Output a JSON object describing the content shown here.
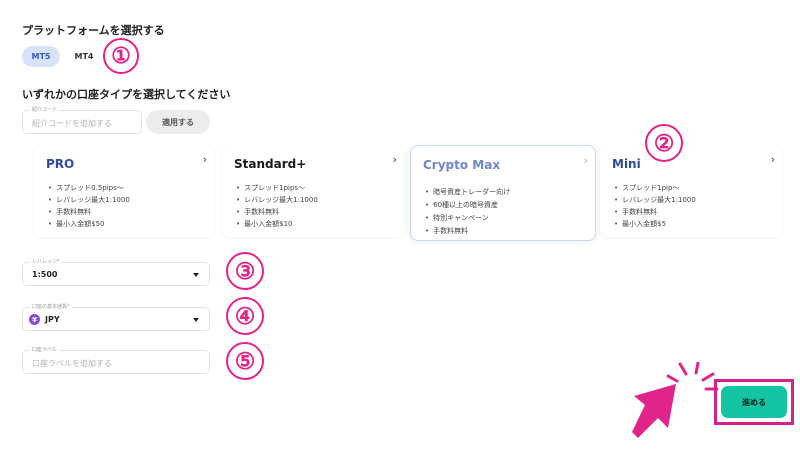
{
  "platform": {
    "title": "プラットフォームを選択する",
    "options": [
      "MT5",
      "MT4"
    ],
    "selected": "MT5"
  },
  "account_type": {
    "title": "いずれかの口座タイプを選択してください"
  },
  "referral": {
    "label": "紹介コード",
    "placeholder": "紹介コードを追加する",
    "apply_label": "適用する"
  },
  "cards": [
    {
      "name": "PRO",
      "features": [
        "スプレッド0.5pips〜",
        "レバレッジ最大1:1000",
        "手数料無料",
        "最小入金額$50"
      ]
    },
    {
      "name": "Standard+",
      "features": [
        "スプレッド1pips〜",
        "レバレッジ最大1:1000",
        "手数料無料",
        "最小入金額$10"
      ]
    },
    {
      "name": "Crypto Max",
      "features": [
        "暗号資産トレーダー向け",
        "60種以上の暗号資産",
        "特別キャンペーン",
        "手数料無料"
      ]
    },
    {
      "name": "Mini",
      "features": [
        "スプレッド1pip〜",
        "レバレッジ最大1:1000",
        "手数料無料",
        "最小入金額$5"
      ]
    }
  ],
  "leverage": {
    "label": "レバレッジ*",
    "value": "1:500"
  },
  "currency": {
    "label": "口座の基本通貨*",
    "symbol": "¥",
    "value": "JPY"
  },
  "account_label": {
    "label": "口座ラベル",
    "placeholder": "口座ラベルを追加する"
  },
  "next_button": {
    "label": "進める"
  },
  "annotations": {
    "n1": "①",
    "n2": "②",
    "n3": "③",
    "n4": "④",
    "n5": "⑤"
  },
  "colors": {
    "annotation": "#e0248a",
    "highlight": "#d1238a",
    "primary": "#14c4a2",
    "selected_pill": "#d8e2f8"
  },
  "icons": {
    "chevron": "chevron-right-icon",
    "caret": "caret-down-icon",
    "pointer": "cursor-arrow-icon",
    "currency": "yen-icon"
  }
}
